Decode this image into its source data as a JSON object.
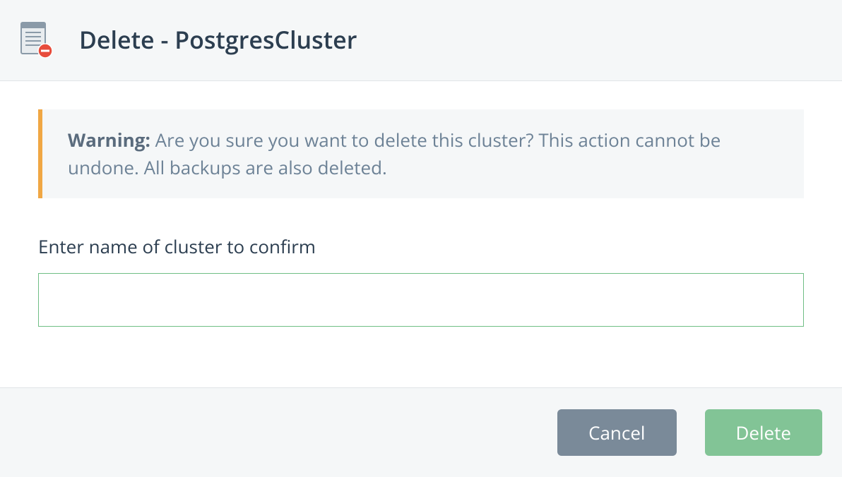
{
  "header": {
    "title": "Delete - PostgresCluster"
  },
  "warning": {
    "label": "Warning:",
    "message": "Are you sure you want to delete this cluster? This action cannot be undone. All backups are also deleted."
  },
  "input": {
    "label": "Enter name of cluster to confirm",
    "value": ""
  },
  "footer": {
    "cancel_label": "Cancel",
    "delete_label": "Delete"
  }
}
